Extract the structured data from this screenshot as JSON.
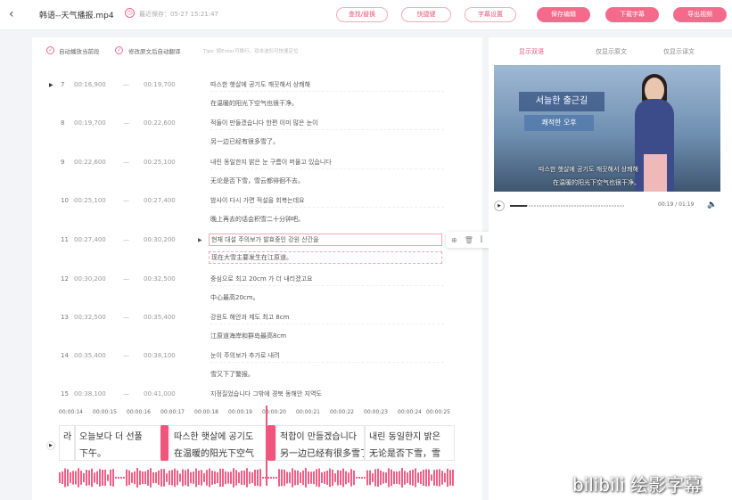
{
  "header": {
    "back": "‹",
    "file_title": "韩语--天气播报.mp4",
    "save_time": "最近保存：05-27 15:21:47",
    "buttons": [
      {
        "label": "查找/替换",
        "style": "outline"
      },
      {
        "label": "快捷键",
        "style": "outline"
      },
      {
        "label": "字幕设置",
        "style": "outline"
      },
      {
        "label": "保存编辑",
        "style": "fill"
      },
      {
        "label": "下载字幕",
        "style": "fill"
      },
      {
        "label": "导出视频",
        "style": "fill"
      }
    ]
  },
  "options": {
    "auto_scroll": "自动播放当前段",
    "auto_translate": "修改原文后自动翻译",
    "hint": "Tips: 按Enter可换行，双击波形可快速定位"
  },
  "rows": [
    {
      "num": "7",
      "start": "00:16,900",
      "end": "00:19,700",
      "ko": "따스한 햇살에 공기도 깨끗해서 상쾌해",
      "zh": "在温暖的阳光下空气也很干净。"
    },
    {
      "num": "8",
      "start": "00:19,700",
      "end": "00:22,600",
      "ko": "적들이 만들겠습니다 한편 이미 많은 눈이",
      "zh": "另一边已经有很多雪了。"
    },
    {
      "num": "9",
      "start": "00:22,600",
      "end": "00:25,100",
      "ko": "내린 동일한지 밝은 눈 구름이 머물고 있습니다",
      "zh": "无论是否下雪，雪云都徘徊不去。"
    },
    {
      "num": "10",
      "start": "00:25,100",
      "end": "00:27,400",
      "ko": "밤사이 다시 가면 적설을 회복는데요",
      "zh": "晚上再去的话会积雪二十分钟吧。"
    },
    {
      "num": "11",
      "start": "00:27,400",
      "end": "00:30,200",
      "ko": "현재 대설 주의보가 발효중인 강원 산간을",
      "zh": "现在大雪主要发生在江原道。"
    },
    {
      "num": "12",
      "start": "00:30,200",
      "end": "00:32,500",
      "ko": "중심으로 최고 20cm 가 더 내리겠고요",
      "zh": "中心最高20cm。"
    },
    {
      "num": "13",
      "start": "00:32,500",
      "end": "00:35,400",
      "ko": "강원도 해안과 제도 최고 8cm",
      "zh": "江原道海岸和群岛最高8cm"
    },
    {
      "num": "14",
      "start": "00:35,400",
      "end": "00:38,100",
      "ko": "눈이 주의보가 추가로 내려",
      "zh": "雪又下了警报。"
    },
    {
      "num": "15",
      "start": "00:38,100",
      "end": "00:41,000",
      "ko": "지정질었습니다 그밖에 경북 동해안 지역도",
      "zh": ""
    }
  ],
  "timeline": {
    "ticks": [
      "00:00:14",
      "00:00:15",
      "00:00:16",
      "00:00:17",
      "00:00:18",
      "00:00:19",
      "00:00:20",
      "00:00:21",
      "00:00:22",
      "00:00:23",
      "00:00:24",
      "00:00:25"
    ],
    "clips": [
      {
        "ko": "오늘보다 더 선풀 ",
        "zh": "下午。"
      },
      {
        "ko": "따스한 햇살에 공기도",
        "zh": "在温暖的阳光下空气"
      },
      {
        "ko": "적합이 만들겠습니다",
        "zh": "另一边已经有很多雪了"
      },
      {
        "ko": "내린 동일한지 밝은",
        "zh": "无论是否下雪，雪"
      }
    ],
    "partial_first": "라",
    "partial_first_zh": ""
  },
  "preview": {
    "tabs": [
      "显示双语",
      "仅显示原文",
      "仅显示译文"
    ],
    "banner1": "서늘한 출근길",
    "banner2": "쾌적한 오후",
    "sub_ko": "따스한 햇살에 공기도 깨끗해서 상쾌해",
    "sub_zh": "在温暖的阳光下空气也很干净。",
    "time": "00:19 / 01:19",
    "progress": 0.15
  },
  "watermark": "bilibili 绘影字幕"
}
